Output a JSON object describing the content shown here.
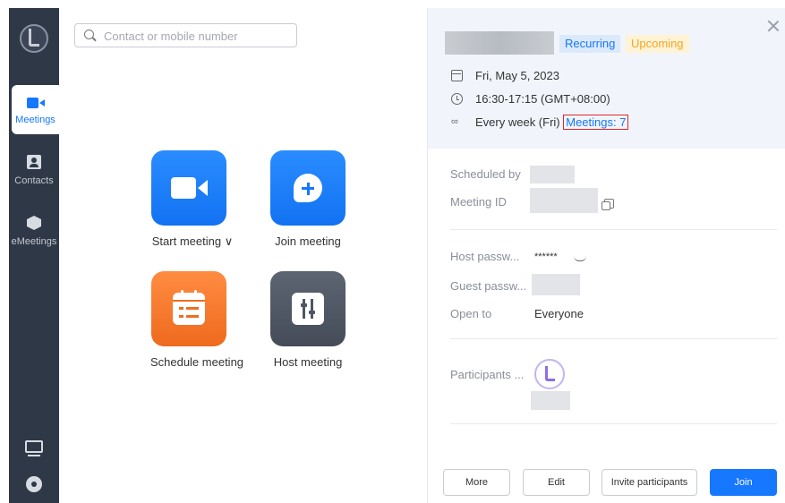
{
  "sidebar": {
    "items": [
      {
        "label": "Meetings",
        "icon": "video-camera-icon",
        "active": true
      },
      {
        "label": "Contacts",
        "icon": "contacts-icon",
        "active": false
      },
      {
        "label": "eMeetings",
        "icon": "cube-icon",
        "active": false
      }
    ],
    "bottom_icons": [
      "screen-share-icon",
      "settings-gear-icon"
    ]
  },
  "search": {
    "placeholder": "Contact or mobile number"
  },
  "actions": [
    {
      "label": "Start meeting ∨",
      "color": "#1677ff"
    },
    {
      "label": "Join meeting",
      "color": "#1677ff"
    },
    {
      "label": "Schedule meeting",
      "color": "#f07a2e"
    },
    {
      "label": "Host meeting",
      "color": "#505765"
    }
  ],
  "details": {
    "badges": {
      "recurring": "Recurring",
      "upcoming": "Upcoming"
    },
    "date": "Fri, May 5, 2023",
    "time": "16:30-17:15 (GMT+08:00)",
    "recurrence": "Every week (Fri)",
    "meetings_count": "Meetings: 7",
    "scheduled_by_label": "Scheduled by",
    "meeting_id_label": "Meeting ID",
    "host_password_label": "Host passw...",
    "host_password_value": "******",
    "guest_password_label": "Guest passw...",
    "open_to_label": "Open to",
    "open_to_value": "Everyone",
    "participants_label": "Participants ..."
  },
  "buttons": {
    "more": "More",
    "edit": "Edit",
    "invite": "Invite participants",
    "join": "Join"
  },
  "colors": {
    "accent": "#1677ff",
    "sidebar": "#2f3847",
    "highlight_box": "#e0262b",
    "upcoming": "#f5a623"
  }
}
